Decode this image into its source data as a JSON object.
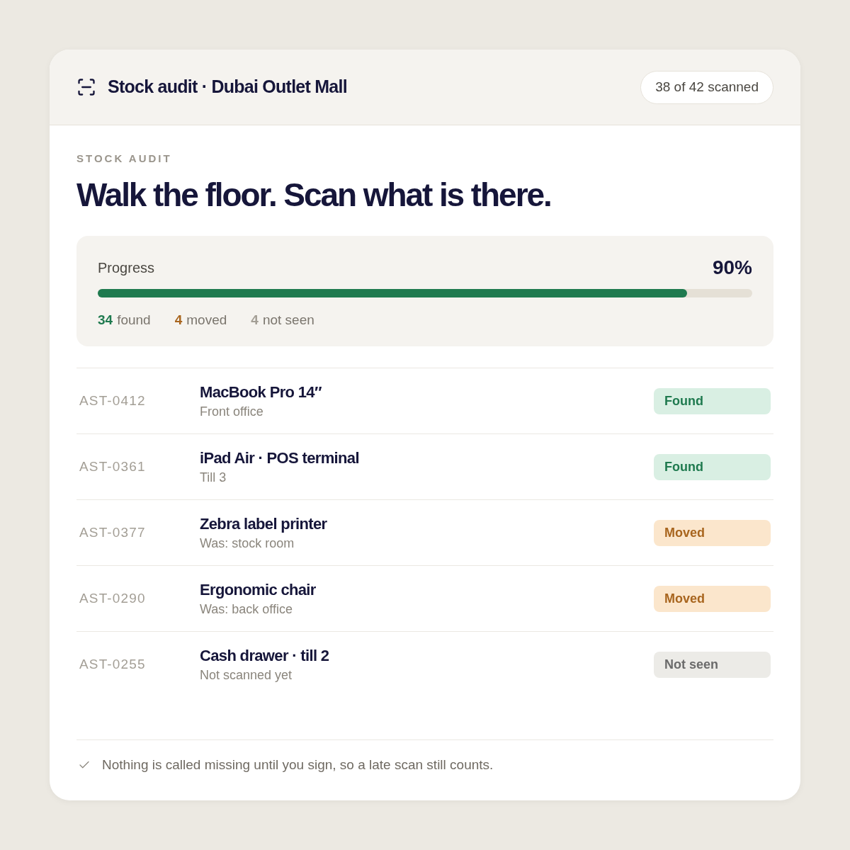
{
  "header": {
    "title": "Stock audit · Dubai Outlet Mall",
    "badge": "38 of 42 scanned"
  },
  "eyebrow": "STOCK AUDIT",
  "heading": "Walk the floor. Scan what is there.",
  "progress": {
    "label": "Progress",
    "percent": "90%",
    "level": 0.9,
    "stats": [
      {
        "kind": "found",
        "count": "34",
        "label": "found"
      },
      {
        "kind": "moved",
        "count": "4",
        "label": "moved"
      },
      {
        "kind": "not_seen",
        "count": "4",
        "label": "not seen"
      }
    ]
  },
  "assets": [
    {
      "id": "AST-0412",
      "name": "MacBook Pro 14″",
      "location": "Front office",
      "status": {
        "kind": "found",
        "label": "Found"
      }
    },
    {
      "id": "AST-0361",
      "name": "iPad Air · POS terminal",
      "location": "Till 3",
      "status": {
        "kind": "found",
        "label": "Found"
      }
    },
    {
      "id": "AST-0377",
      "name": "Zebra label printer",
      "location": "Was: stock room",
      "status": {
        "kind": "moved",
        "label": "Moved"
      }
    },
    {
      "id": "AST-0290",
      "name": "Ergonomic chair",
      "location": "Was: back office",
      "status": {
        "kind": "moved",
        "label": "Moved"
      }
    },
    {
      "id": "AST-0255",
      "name": "Cash drawer · till 2",
      "location": "Not scanned yet",
      "status": {
        "kind": "not_seen",
        "label": "Not seen"
      }
    }
  ],
  "footer": {
    "note": "Nothing is called missing until you sign, so a late scan still counts."
  }
}
